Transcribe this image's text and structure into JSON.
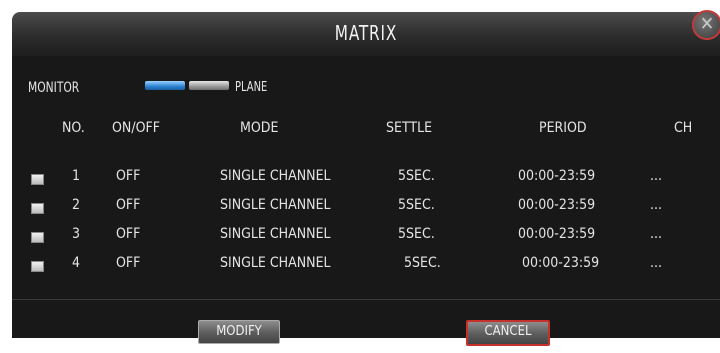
{
  "dialog": {
    "title": "MATRIX",
    "close_glyph": "✕"
  },
  "monitor": {
    "label": "MONITOR",
    "selector_label": "PLANE",
    "selector_colors": {
      "active": "#2b82d1",
      "inactive": "#9a9a9a"
    }
  },
  "table": {
    "headers": {
      "no": "NO.",
      "onoff": "ON/OFF",
      "mode": "MODE",
      "settle": "SETTLE",
      "period": "PERIOD",
      "ch": "CH"
    },
    "rows": [
      {
        "no": "1",
        "onoff": "OFF",
        "mode": "SINGLE  CHANNEL",
        "settle": "5SEC.",
        "period": "00:00-23:59",
        "ch": "..."
      },
      {
        "no": "2",
        "onoff": "OFF",
        "mode": "SINGLE  CHANNEL",
        "settle": "5SEC.",
        "period": "00:00-23:59",
        "ch": "..."
      },
      {
        "no": "3",
        "onoff": "OFF",
        "mode": "SINGLE  CHANNEL",
        "settle": "5SEC.",
        "period": "00:00-23:59",
        "ch": "..."
      },
      {
        "no": "4",
        "onoff": "OFF",
        "mode": "SINGLE  CHANNEL",
        "settle": "5SEC.",
        "period": "00:00-23:59",
        "ch": "..."
      }
    ]
  },
  "buttons": {
    "modify": "MODIFY",
    "cancel": "CANCEL"
  }
}
